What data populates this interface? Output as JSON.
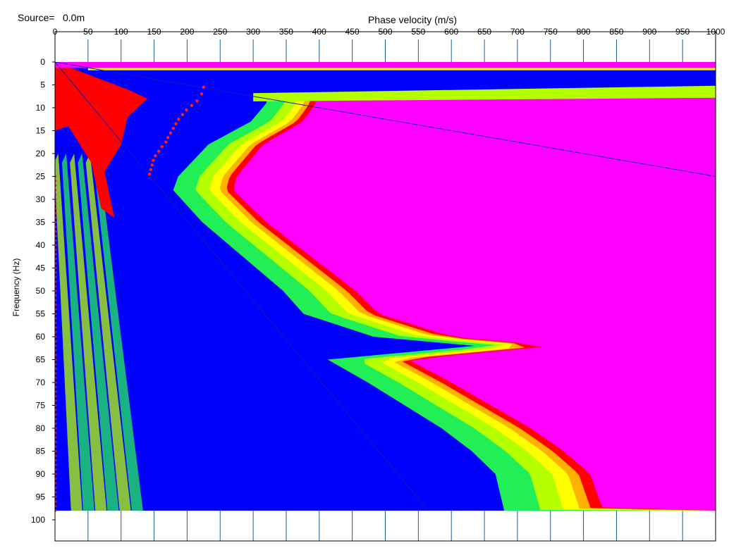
{
  "header": {
    "source_label": "Source=",
    "source_value": "0.0m"
  },
  "chart_data": {
    "type": "heatmap",
    "title": "",
    "xlabel": "Phase velocity (m/s)",
    "ylabel": "Frequency (Hz)",
    "xlim": [
      0,
      1000
    ],
    "ylim": [
      0,
      100
    ],
    "x_ticks": [
      0,
      50,
      100,
      150,
      200,
      250,
      300,
      350,
      400,
      450,
      500,
      550,
      600,
      650,
      700,
      750,
      800,
      850,
      900,
      950,
      1000
    ],
    "y_ticks": [
      0,
      5,
      10,
      15,
      20,
      25,
      30,
      35,
      40,
      45,
      50,
      55,
      60,
      65,
      70,
      75,
      80,
      85,
      90,
      95,
      100
    ],
    "y_axis_inverted": true,
    "grid": false,
    "colormap": [
      "#0000ff",
      "#0a6bff",
      "#00d8ff",
      "#22ee55",
      "#b4ff00",
      "#ffff00",
      "#ffb000",
      "#ff6000",
      "#ff0000",
      "#ff00ff"
    ],
    "data_extent_frequency": [
      0,
      98
    ],
    "front_edge_of_high_band": [
      {
        "f": 9,
        "v": 395
      },
      {
        "f": 13,
        "v": 375
      },
      {
        "f": 18,
        "v": 315
      },
      {
        "f": 25,
        "v": 275
      },
      {
        "f": 28,
        "v": 270
      },
      {
        "f": 35,
        "v": 320
      },
      {
        "f": 40,
        "v": 365
      },
      {
        "f": 45,
        "v": 410
      },
      {
        "f": 50,
        "v": 455
      },
      {
        "f": 55,
        "v": 490
      },
      {
        "f": 60,
        "v": 600
      },
      {
        "f": 62,
        "v": 755
      },
      {
        "f": 65,
        "v": 535
      },
      {
        "f": 70,
        "v": 600
      },
      {
        "f": 75,
        "v": 660
      },
      {
        "f": 80,
        "v": 720
      },
      {
        "f": 85,
        "v": 770
      },
      {
        "f": 90,
        "v": 810
      },
      {
        "f": 98,
        "v": 830
      }
    ],
    "blue_ridge": [
      {
        "f": 5,
        "v": 175
      },
      {
        "f": 20,
        "v": 165
      },
      {
        "f": 40,
        "v": 190
      },
      {
        "f": 60,
        "v": 200
      },
      {
        "f": 80,
        "v": 215
      },
      {
        "f": 98,
        "v": 200
      }
    ],
    "picked_points": [
      {
        "f": 5.5,
        "v": 225
      },
      {
        "f": 7,
        "v": 222
      },
      {
        "f": 8.5,
        "v": 215
      },
      {
        "f": 9.5,
        "v": 207
      },
      {
        "f": 10.5,
        "v": 199
      },
      {
        "f": 11.5,
        "v": 193
      },
      {
        "f": 12.5,
        "v": 187
      },
      {
        "f": 13.5,
        "v": 183
      },
      {
        "f": 14.5,
        "v": 179
      },
      {
        "f": 15.5,
        "v": 175
      },
      {
        "f": 16.5,
        "v": 171
      },
      {
        "f": 17.5,
        "v": 168
      },
      {
        "f": 18.5,
        "v": 162
      },
      {
        "f": 19.5,
        "v": 157
      },
      {
        "f": 20.5,
        "v": 152
      },
      {
        "f": 21.5,
        "v": 149
      },
      {
        "f": 22.5,
        "v": 147
      },
      {
        "f": 23.5,
        "v": 145
      },
      {
        "f": 24.5,
        "v": 143
      }
    ],
    "reference_lines": [
      {
        "from": {
          "v": 0,
          "f": 0
        },
        "to": {
          "v": 1000,
          "f": 25
        }
      },
      {
        "from": {
          "v": 0,
          "f": 0
        },
        "to": {
          "v": 565,
          "f": 98
        }
      }
    ]
  }
}
